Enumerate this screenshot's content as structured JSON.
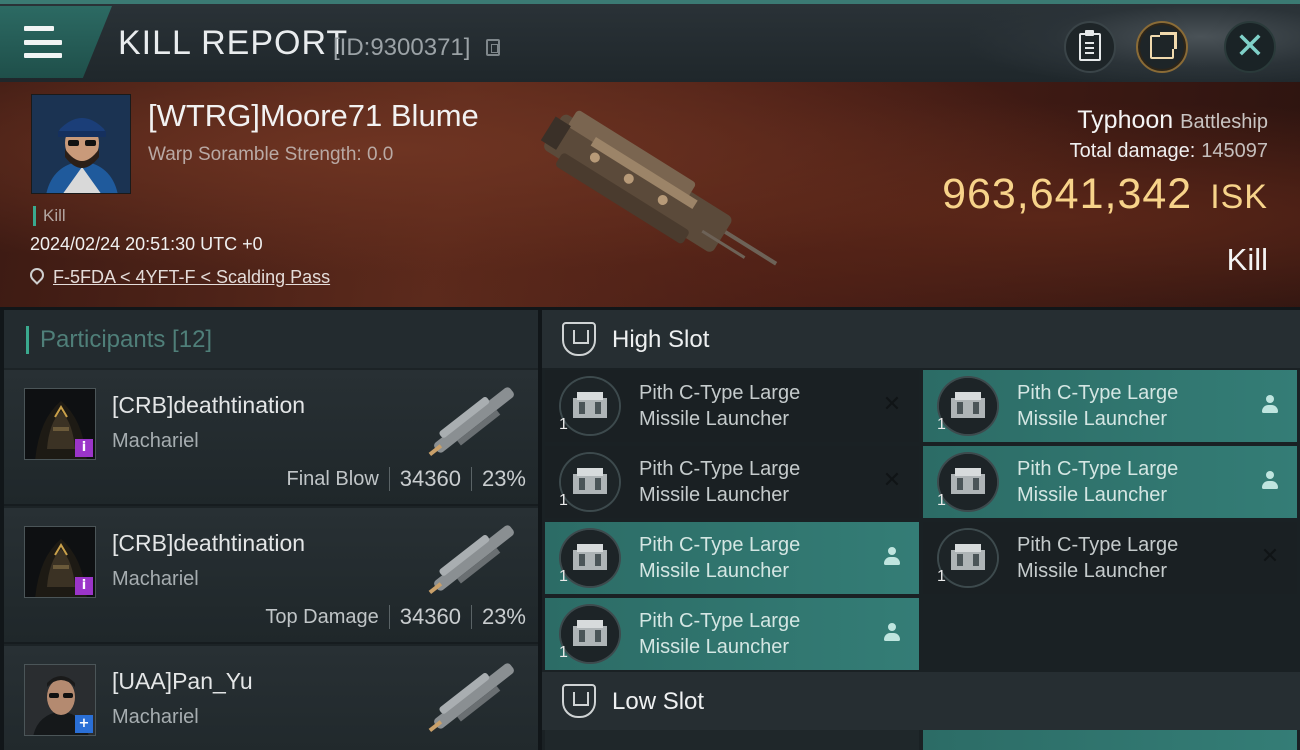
{
  "header": {
    "title": "KILL REPORT",
    "report_id": "[ID:9300371]",
    "icons": [
      "menu-icon",
      "copy-icon",
      "clipboard-icon",
      "share-icon",
      "close-icon"
    ]
  },
  "banner": {
    "pilot_name": "[WTRG]Moore71 Blume",
    "warp_scramble": "Warp Soramble Strength: 0.0",
    "kill_tag": "Kill",
    "datetime": "2024/02/24 20:51:30 UTC +0",
    "location": "F-5FDA < 4YFT-F < Scalding Pass",
    "ship_name": "Typhoon",
    "ship_class": "Battleship",
    "total_damage_label": "Total damage:",
    "total_damage": "145097",
    "isk_value": "963,641,342",
    "isk_unit": "ISK",
    "result": "Kill"
  },
  "participants": {
    "header": "Participants [12]",
    "rows": [
      {
        "name": "[CRB]deathtination",
        "ship": "Machariel",
        "label": "Final Blow",
        "damage": "34360",
        "percent": "23%",
        "badge": "i"
      },
      {
        "name": "[CRB]deathtination",
        "ship": "Machariel",
        "label": "Top Damage",
        "damage": "34360",
        "percent": "23%",
        "badge": "i"
      },
      {
        "name": "[UAA]Pan_Yu",
        "ship": "Machariel",
        "badge": "+"
      }
    ]
  },
  "slots": {
    "high_slot_title": "High Slot",
    "low_slot_title": "Low Slot",
    "high_modules": [
      {
        "line1": "Pith C-Type Large",
        "line2": "Missile Launcher",
        "qty": "1",
        "status": "destroyed"
      },
      {
        "line1": "Pith C-Type Large",
        "line2": "Missile Launcher",
        "qty": "1",
        "status": "dropped"
      },
      {
        "line1": "Pith C-Type Large",
        "line2": "Missile Launcher",
        "qty": "1",
        "status": "destroyed"
      },
      {
        "line1": "Pith C-Type Large",
        "line2": "Missile Launcher",
        "qty": "1",
        "status": "dropped"
      },
      {
        "line1": "Pith C-Type Large",
        "line2": "Missile Launcher",
        "qty": "1",
        "status": "dropped"
      },
      {
        "line1": "Pith C-Type Large",
        "line2": "Missile Launcher",
        "qty": "1",
        "status": "destroyed"
      },
      {
        "line1": "Pith C-Type Large",
        "line2": "Missile Launcher",
        "qty": "1",
        "status": "dropped"
      }
    ]
  },
  "colors": {
    "accent_teal": "#2c6c66",
    "isk_gold": "#f7d38a",
    "badge_purple": "#9b35c9",
    "badge_blue": "#2a6fd6"
  }
}
